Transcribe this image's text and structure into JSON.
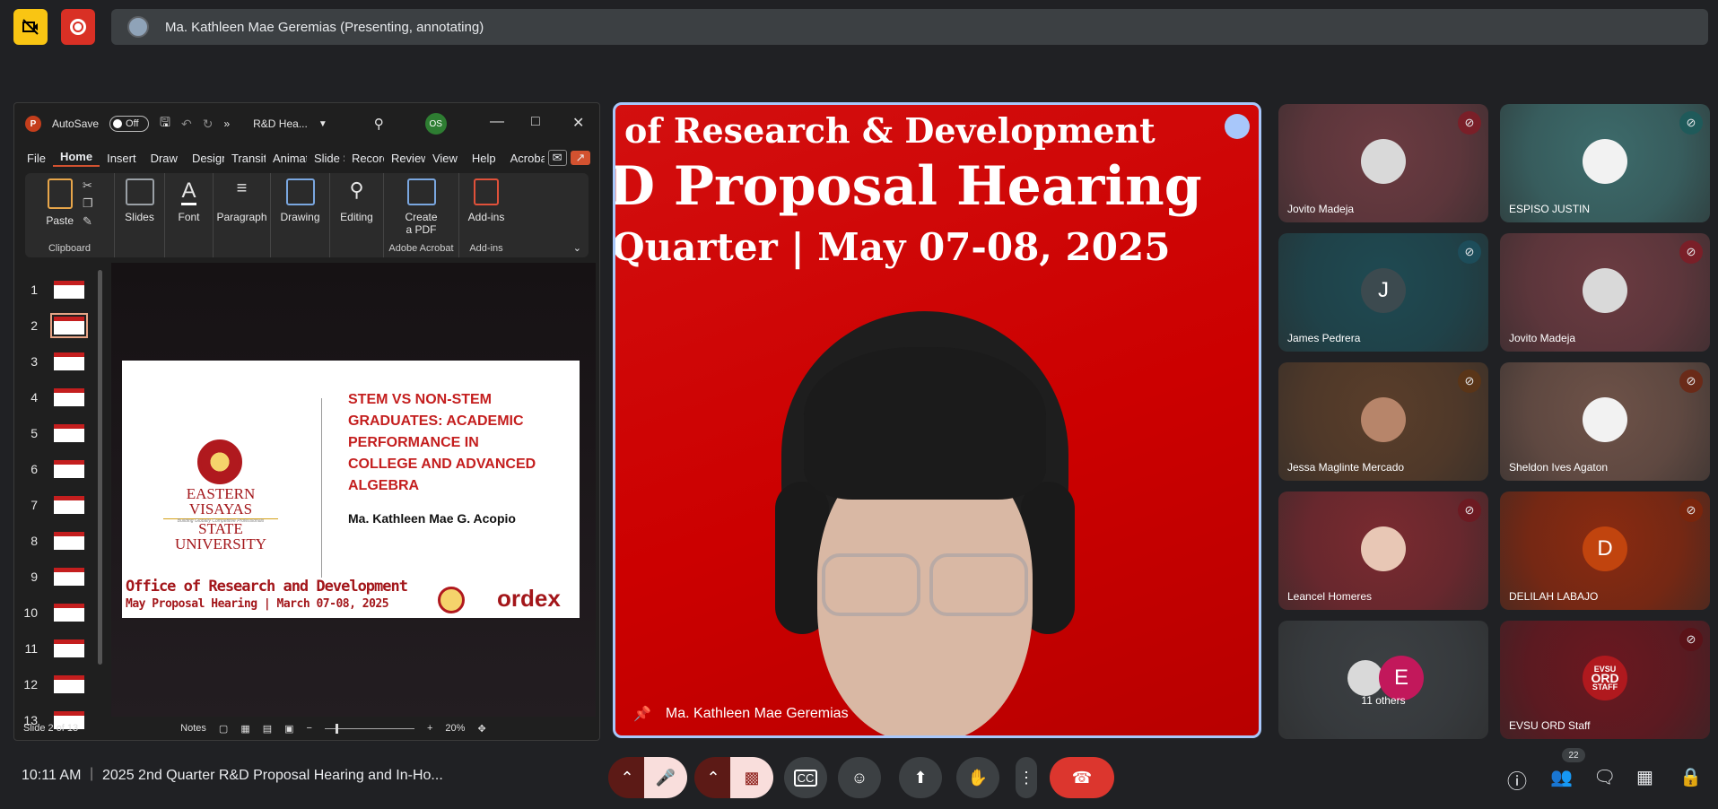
{
  "top": {
    "presenter_banner": "Ma. Kathleen Mae Geremias (Presenting, annotating)"
  },
  "ppt": {
    "autosave_label": "AutoSave",
    "autosave_state": "Off",
    "doc_name": "R&D Hea...",
    "user_initials": "OS",
    "tabs": [
      "File",
      "Home",
      "Insert",
      "Draw",
      "Design",
      "Transitions",
      "Animations",
      "Slide Show",
      "Record",
      "Review",
      "View",
      "Help",
      "Acrobat"
    ],
    "ribbon": {
      "paste": "Paste",
      "clipboard": "Clipboard",
      "slides": "Slides",
      "font": "Font",
      "paragraph": "Paragraph",
      "drawing": "Drawing",
      "editing": "Editing",
      "create_pdf_1": "Create",
      "create_pdf_2": "a PDF",
      "adobe": "Adobe Acrobat",
      "addins": "Add-ins",
      "addins_group": "Add-ins"
    },
    "slide_numbers": [
      "1",
      "2",
      "3",
      "4",
      "5",
      "6",
      "7",
      "8",
      "9",
      "10",
      "11",
      "12",
      "13"
    ],
    "slide": {
      "university_1": "EASTERN VISAYAS",
      "university_2": "STATE UNIVERSITY",
      "motto": "Building Globally Competitive Professionals",
      "title_lines": [
        "STEM VS NON-STEM",
        "GRADUATES: ACADEMIC",
        "PERFORMANCE IN",
        "COLLEGE AND ADVANCED",
        "ALGEBRA"
      ],
      "author": "Ma. Kathleen Mae G. Acopio",
      "office": "Office of Research and Development",
      "hearing": "May Proposal Hearing | March 07-08, 2025",
      "brand": "ordex"
    },
    "status": {
      "slide_of": "Slide 2 of 13",
      "notes": "Notes",
      "zoom": "20%"
    }
  },
  "presenter": {
    "bg_line1": "of Research & Development",
    "bg_line2": "D Proposal Hearing",
    "bg_line3": "Quarter | May 07-08, 2025",
    "name": "Ma. Kathleen Mae Geremias"
  },
  "participants": [
    {
      "name": "Jovito Madeja",
      "initial": "",
      "bg": "#6b3b41",
      "avatar_bg": "#d9d9d9",
      "mute_bg": "#7a1f28"
    },
    {
      "name": "ESPISO JUSTIN",
      "initial": "",
      "bg": "#3d6b6b",
      "avatar_bg": "#f2f2f2",
      "mute_bg": "#1f5a5a"
    },
    {
      "name": "James Pedrera",
      "initial": "J",
      "bg": "#1f4a52",
      "avatar_bg": "#3c4a4f",
      "mute_bg": "#1d4d5a"
    },
    {
      "name": "Jovito Madeja",
      "initial": "",
      "bg": "#6b3b41",
      "avatar_bg": "#d9d9d9",
      "mute_bg": "#7a1f28"
    },
    {
      "name": "Jessa Maglinte Mercado",
      "initial": "",
      "bg": "#5a3e2a",
      "avatar_bg": "#b7856a",
      "mute_bg": "#5a3518"
    },
    {
      "name": "Sheldon Ives Agaton",
      "initial": "",
      "bg": "#6e5248",
      "avatar_bg": "#f2f2f2",
      "mute_bg": "#6a2a18"
    },
    {
      "name": "Leancel Homeres",
      "initial": "",
      "bg": "#7a2a30",
      "avatar_bg": "#e8c7b5",
      "mute_bg": "#6d1a22"
    },
    {
      "name": "DELILAH LABAJO",
      "initial": "D",
      "bg": "#8a2a10",
      "avatar_bg": "#c1440e",
      "mute_bg": "#7a250c"
    },
    {
      "name": "11 others",
      "initial": "E",
      "bg": "#3c4043",
      "avatar_bg": "#c2185b",
      "mute_bg": ""
    },
    {
      "name": "EVSU ORD Staff",
      "initial": "",
      "bg": "#6a1820",
      "avatar_bg": "#b0191e",
      "mute_bg": "#5a1218"
    }
  ],
  "ord_badge": [
    "EVSU",
    "ORD",
    "STAFF"
  ],
  "bottom": {
    "time": "10:11 AM",
    "meeting_title": "2025 2nd Quarter R&D Proposal Hearing and In-Ho...",
    "people_count": "22"
  }
}
